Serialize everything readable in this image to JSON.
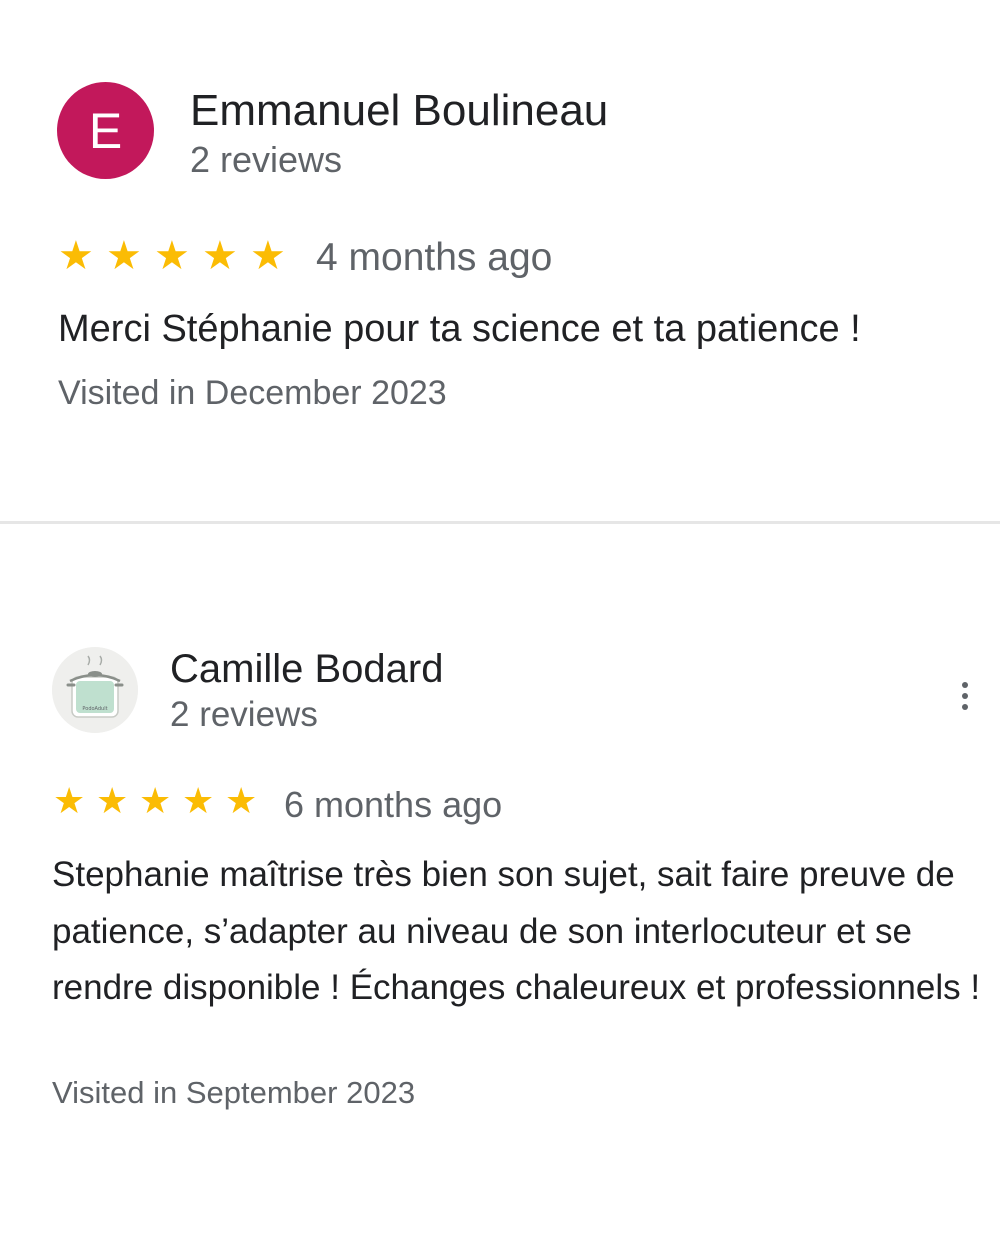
{
  "reviews": [
    {
      "avatar_letter": "E",
      "avatar_color": "#c2185b",
      "author": "Emmanuel Boulineau",
      "review_count": "2 reviews",
      "stars": "★★★★★",
      "rating": 5,
      "time_ago": "4 months ago",
      "text": "Merci Stéphanie pour ta science et ta patience !",
      "visited": "Visited in December 2023"
    },
    {
      "avatar_icon": "cooking-pot-sticker-icon",
      "avatar_label": "PodoAdult",
      "author": "Camille Bodard",
      "review_count": "2 reviews",
      "stars": "★★★★★",
      "rating": 5,
      "time_ago": "6 months ago",
      "text": "Stephanie maîtrise très bien son sujet, sait faire preuve de patience, s’adapter au niveau de son interlocuteur et se rendre disponible ! Échanges chaleureux et professionnels !",
      "visited": "Visited in September 2023"
    }
  ],
  "colors": {
    "star": "#fbbc04",
    "secondary_text": "#5f6368",
    "primary_text": "#202124"
  },
  "icons": {
    "more_options": "more-vert-icon",
    "star": "star-icon"
  }
}
